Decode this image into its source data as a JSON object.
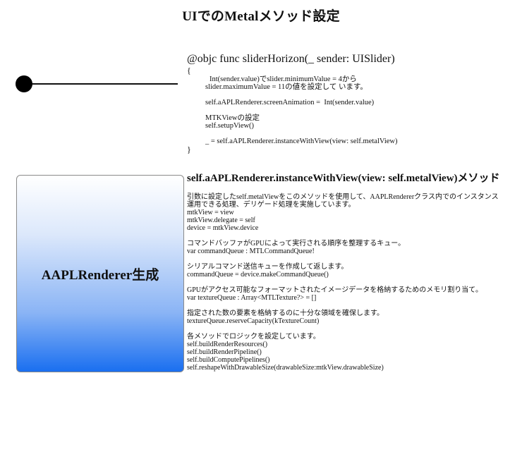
{
  "page": {
    "title": "UIでのMetalメソッド設定"
  },
  "slider": {
    "value_fraction": 0
  },
  "code": {
    "heading": "@objc func sliderHorizon(_ sender: UISlider)",
    "open_brace": "{",
    "lines": [
      "Int(sender.value)でslider.minimumValue = 4から",
      "slider.maximumValue = 11の値を設定して います。",
      "",
      "self.aAPLRenderer.screenAnimation =  Int(sender.value)",
      "",
      "MTKViewの設定",
      "self.setupView()",
      "",
      "_ = self.aAPLRenderer.instanceWithView(view: self.metalView)"
    ],
    "close_brace": "}"
  },
  "box": {
    "label": "AAPLRenderer生成"
  },
  "description": {
    "heading": "self.aAPLRenderer.instanceWithView(view: self.metalView)メソッド",
    "lines": [
      "引数に設定したself.metalViewをこのメソッドを使用して、AAPLRendererクラス内でのインスタンス",
      "運用できる処理、デリゲード処理を実施しています。",
      "mtkView = view",
      "mtkView.delegate = self",
      "device = mtkView.device",
      "",
      "コマンドバッファがGPUによって実行される順序を整理するキュー。",
      "var commandQueue : MTLCommandQueue!",
      "",
      "シリアルコマンド送信キューを作成して返します。",
      "commandQueue = device.makeCommandQueue()",
      "",
      "GPUがアクセス可能なフォーマットされたイメージデータを格納するためのメモリ割り当て。",
      "var textureQueue : Array<MTLTexture?> = []",
      "",
      "指定された数の要素を格納するのに十分な領域を確保します。",
      "textureQueue.reserveCapacity(kTextureCount)",
      "",
      "各メソッドでロジックを設定しています。",
      "self.buildRenderResources()",
      "self.buildRenderPipeline()",
      "self.buildComputePipelines()",
      "self.reshapeWithDrawableSize(drawableSize:mtkView.drawableSize)"
    ]
  }
}
